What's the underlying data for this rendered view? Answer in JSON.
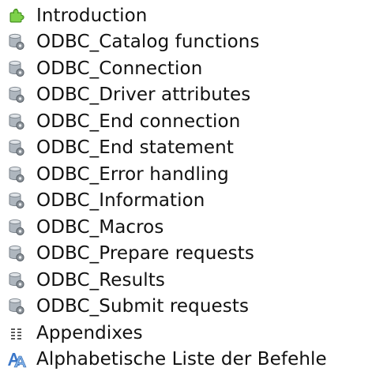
{
  "tree": {
    "items": [
      {
        "label": "Introduction",
        "icon": "puzzle-icon",
        "id": "introduction"
      },
      {
        "label": "ODBC_Catalog functions",
        "icon": "database-gear-icon",
        "id": "odbc-catalog-functions"
      },
      {
        "label": "ODBC_Connection",
        "icon": "database-gear-icon",
        "id": "odbc-connection"
      },
      {
        "label": "ODBC_Driver attributes",
        "icon": "database-gear-icon",
        "id": "odbc-driver-attributes"
      },
      {
        "label": "ODBC_End connection",
        "icon": "database-gear-icon",
        "id": "odbc-end-connection"
      },
      {
        "label": "ODBC_End statement",
        "icon": "database-gear-icon",
        "id": "odbc-end-statement"
      },
      {
        "label": "ODBC_Error handling",
        "icon": "database-gear-icon",
        "id": "odbc-error-handling"
      },
      {
        "label": "ODBC_Information",
        "icon": "database-gear-icon",
        "id": "odbc-information"
      },
      {
        "label": "ODBC_Macros",
        "icon": "database-gear-icon",
        "id": "odbc-macros"
      },
      {
        "label": "ODBC_Prepare requests",
        "icon": "database-gear-icon",
        "id": "odbc-prepare-requests"
      },
      {
        "label": "ODBC_Results",
        "icon": "database-gear-icon",
        "id": "odbc-results"
      },
      {
        "label": "ODBC_Submit requests",
        "icon": "database-gear-icon",
        "id": "odbc-submit-requests"
      },
      {
        "label": "Appendixes",
        "icon": "list-columns-icon",
        "id": "appendixes"
      },
      {
        "label": "Alphabetische Liste der Befehle",
        "icon": "alphabet-icon",
        "id": "alphabetische-liste"
      }
    ]
  },
  "colors": {
    "puzzle": "#6cbf3a",
    "database": "#9ea7b0",
    "gear": "#6d747b",
    "alphabet_blue": "#3a77c9",
    "list": "#5a5a5a"
  }
}
